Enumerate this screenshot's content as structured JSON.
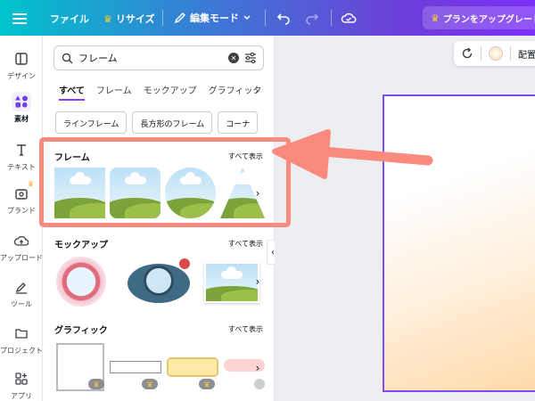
{
  "topbar": {
    "file": "ファイル",
    "resize": "リサイズ",
    "edit_mode": "編集モード",
    "upgrade": "プランをアップグレード"
  },
  "rail": [
    {
      "label": "デザイン",
      "icon": "layout-icon"
    },
    {
      "label": "素材",
      "icon": "elements-icon"
    },
    {
      "label": "テキスト",
      "icon": "text-icon"
    },
    {
      "label": "ブランド",
      "icon": "brand-icon"
    },
    {
      "label": "アップロード",
      "icon": "upload-icon"
    },
    {
      "label": "ツール",
      "icon": "draw-icon"
    },
    {
      "label": "プロジェクト",
      "icon": "folder-icon"
    },
    {
      "label": "アプリ",
      "icon": "apps-icon"
    }
  ],
  "search": {
    "value": "フレーム"
  },
  "tabs": [
    "すべて",
    "フレーム",
    "モックアップ",
    "グラフィック"
  ],
  "chips": [
    "ラインフレーム",
    "長方形のフレーム",
    "コーナ"
  ],
  "sections": {
    "frame": {
      "title": "フレーム",
      "see_all": "すべて表示"
    },
    "mockup": {
      "title": "モックアップ",
      "see_all": "すべて表示"
    },
    "graphic": {
      "title": "グラフィック",
      "see_all": "すべて表示"
    }
  },
  "canvas_toolbar": {
    "label": "配置"
  },
  "colors": {
    "accent": "#8b3dff",
    "highlight": "#f98a7d",
    "crown": "#ffcc33"
  }
}
